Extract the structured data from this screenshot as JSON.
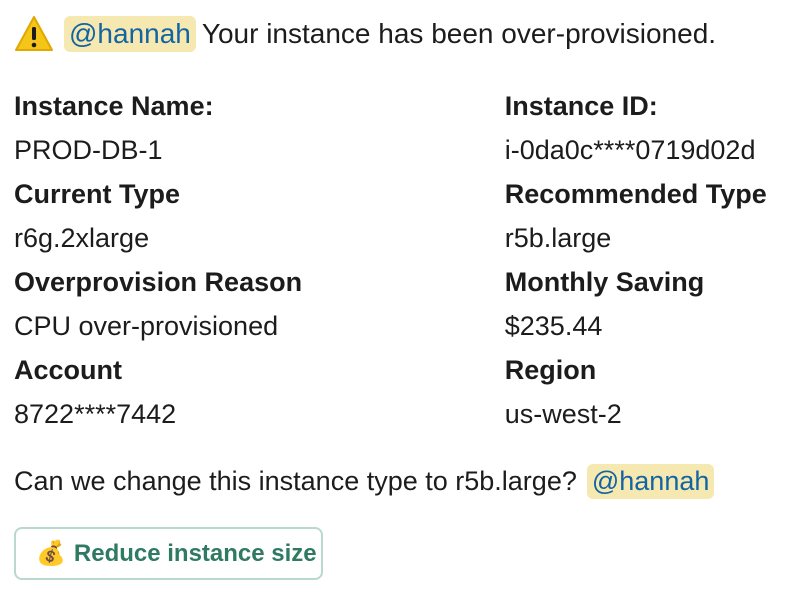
{
  "header": {
    "icon": "warning-icon",
    "mention": "@hannah",
    "message": "Your instance has been over-provisioned."
  },
  "fields": [
    {
      "left_label": "Instance Name:",
      "left_value": "PROD-DB-1",
      "right_label": "Instance ID:",
      "right_value": "i-0da0c****0719d02d"
    },
    {
      "left_label": "Current Type",
      "left_value": "r6g.2xlarge",
      "right_label": "Recommended Type",
      "right_value": "r5b.large"
    },
    {
      "left_label": "Overprovision Reason",
      "left_value": "CPU over-provisioned",
      "right_label": "Monthly Saving",
      "right_value": "$235.44"
    },
    {
      "left_label": "Account",
      "left_value": "8722****7442",
      "right_label": "Region",
      "right_value": "us-west-2"
    }
  ],
  "question": {
    "text": "Can we change this instance type to r5b.large?",
    "mention": "@hannah"
  },
  "action": {
    "icon": "money-bag-icon",
    "emoji": "💰",
    "label": "Reduce instance size"
  },
  "colors": {
    "mention_bg": "#f6e8b1",
    "mention_text": "#1264a3",
    "button_text": "#2f7a62",
    "button_border": "#b9d9cd",
    "warning_yellow": "#f5c518"
  }
}
